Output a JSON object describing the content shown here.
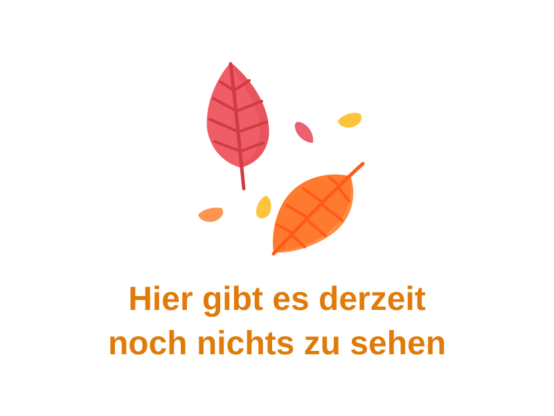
{
  "empty_state": {
    "line1": "Hier gibt es derzeit",
    "line2": "noch nichts zu sehen",
    "text_color": "#e07b0a"
  },
  "illustration": {
    "icon": "autumn-leaves-icon",
    "colors": {
      "red_leaf": "#ee5d68",
      "red_leaf_vein": "#d23a44",
      "orange_leaf": "#ff7a2e",
      "orange_leaf_vein": "#ff5a16",
      "petal_pink": "#ea6170",
      "petal_yellow": "#fcc33d",
      "petal_orange": "#ff9550"
    }
  }
}
